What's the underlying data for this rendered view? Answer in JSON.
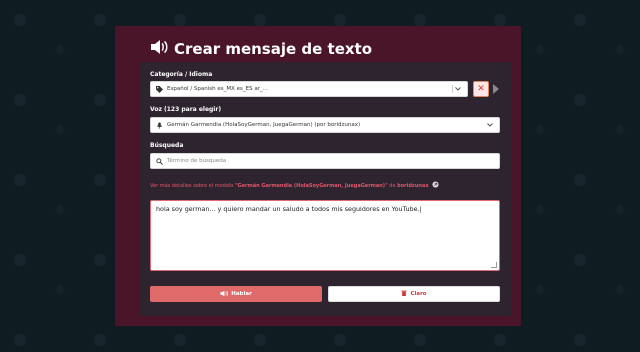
{
  "header": {
    "title": "Crear mensaje de texto",
    "icon": "speaker-icon"
  },
  "category": {
    "label": "Categoría / Idioma",
    "value": "Español / Spanish es_MX es_ES ar_...",
    "icon": "tag-icon"
  },
  "voice": {
    "label": "Voz (123 para elegir)",
    "value": "Germán Garmendia (HolaSoyGerman, JuegaGerman) (por boridzunax)",
    "icon": "microphone-icon"
  },
  "search": {
    "label": "Búsqueda",
    "placeholder": "Término de búsqueda",
    "icon": "search-icon"
  },
  "info": {
    "prefix": "Ver más detalles sobre el modelo ",
    "model": "\"Germán Garmendia (HolaSoyGerman, JuegaGerman)\"",
    "middle": " de ",
    "author": "boridzunax"
  },
  "message": {
    "text": "hola soy german... y quiero mandar un saludo a todos mis seguidores en YouTube.|"
  },
  "buttons": {
    "speak": "Hablar",
    "clear": "Claro"
  },
  "colors": {
    "accent": "#e06a6a",
    "card": "#2e2430",
    "outer": "#4a1429",
    "page": "#0f1c21"
  }
}
